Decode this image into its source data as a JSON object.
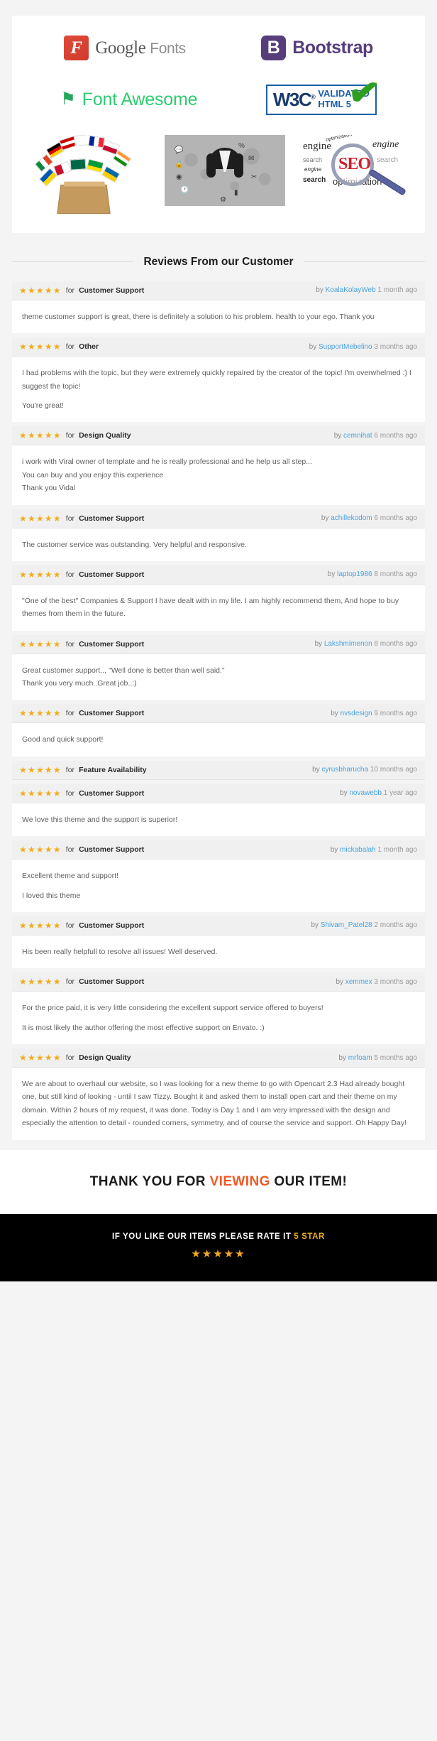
{
  "features": {
    "logos": [
      {
        "name": "google-fonts",
        "badge": "F",
        "text_strong": "Google",
        "text_light": "Fonts"
      },
      {
        "name": "bootstrap",
        "badge": "B",
        "text_strong": "Bootstrap",
        "text_light": ""
      },
      {
        "name": "font-awesome",
        "badge": "⚑",
        "text_strong": "Font Awesome",
        "text_light": ""
      },
      {
        "name": "w3c-validated-html5",
        "mark": "W3C",
        "sup": "®",
        "line1": "VALIDATED",
        "line2": "HTML 5",
        "check": "✔"
      }
    ],
    "illustrations": [
      {
        "name": "multi-language-flags"
      },
      {
        "name": "customer-support-agent"
      },
      {
        "name": "seo-optimization"
      }
    ],
    "seo_words": [
      "optimization",
      "engine",
      "search",
      "engine",
      "search",
      "engine",
      "search",
      "optimization",
      "SEO"
    ]
  },
  "reviews_section": {
    "title": "Reviews From our Customer",
    "star_glyph": "★",
    "for_label": "for",
    "by_label": "by",
    "items": [
      {
        "stars": 5,
        "category": "Customer Support",
        "user": "KoalaKolayWeb",
        "time": "1 month ago",
        "paragraphs": [
          "theme customer support is great, there is definitely a solution to his problem. health to your ego. Thank you"
        ]
      },
      {
        "stars": 5,
        "category": "Other",
        "user": "SupportMebelino",
        "time": "3 months ago",
        "paragraphs": [
          "I had problems with the topic, but they were extremely quickly repaired by the creator of the topic! I'm overwhelmed :) I suggest the topic!",
          "You're great!"
        ]
      },
      {
        "stars": 5,
        "category": "Design Quality",
        "user": "cemnihat",
        "time": "6 months ago",
        "paragraphs": [
          "i work with Viral owner of template and he is really professional and he help us all step...\nYou can buy and you enjoy this experience\nThank you Vidal"
        ]
      },
      {
        "stars": 5,
        "category": "Customer Support",
        "user": "achillekodom",
        "time": "6 months ago",
        "paragraphs": [
          "The customer service was outstanding. Very helpful and responsive."
        ]
      },
      {
        "stars": 5,
        "category": "Customer Support",
        "user": "laptop1986",
        "time": "8 months ago",
        "paragraphs": [
          "\"One of the best\" Companies & Support I have dealt with in my life. I am highly recommend them, And hope to buy themes from them in the future."
        ]
      },
      {
        "stars": 5,
        "category": "Customer Support",
        "user": "Lakshmimenon",
        "time": "8 months ago",
        "paragraphs": [
          "Great customer support.., \"Well done is better than well said.\"\nThank you very much..Great job..:)"
        ]
      },
      {
        "stars": 5,
        "category": "Customer Support",
        "user": "nvsdesign",
        "time": "9 months ago",
        "paragraphs": [
          "Good and quick support!"
        ]
      },
      {
        "stars": 5,
        "category": "Feature Availability",
        "user": "cyrusbharucha",
        "time": "10 months ago",
        "paragraphs": []
      },
      {
        "stars": 5,
        "category": "Customer Support",
        "user": "novawebb",
        "time": "1 year ago",
        "paragraphs": [
          "We love this theme and the support is superior!"
        ]
      },
      {
        "stars": 5,
        "category": "Customer Support",
        "user": "mickabalah",
        "time": "1 month ago",
        "paragraphs": [
          "Excellent theme and support!",
          "I loved this theme"
        ]
      },
      {
        "stars": 5,
        "category": "Customer Support",
        "user": "Shivam_Patel28",
        "time": "2 months ago",
        "paragraphs": [
          "His been really helpfull to resolve all issues! Well deserved."
        ]
      },
      {
        "stars": 5,
        "category": "Customer Support",
        "user": "xemmex",
        "time": "3 months ago",
        "paragraphs": [
          "For the price paid, it is very little considering the excellent support service offered to buyers!",
          "It is most likely the author offering the most effective support on Envato. :)"
        ]
      },
      {
        "stars": 5,
        "category": "Design Quality",
        "user": "mrfoam",
        "time": "5 months ago",
        "paragraphs": [
          "We are about to overhaul our website, so I was looking for a new theme to go with Opencart 2.3 Had already bought one, but still kind of looking - until I saw Tizzy. Bought it and asked them to install open cart and their theme on my domain. Within 2 hours of my request, it was done. Today is Day 1 and I am very impressed with the design and especially the attention to detail - rounded corners, symmetry, and of course the service and support. Oh Happy Day!"
        ]
      }
    ]
  },
  "thank_you": {
    "before": "THANK YOU FOR ",
    "highlight": "VIEWING",
    "after": " OUR ITEM!"
  },
  "footer": {
    "before": "IF YOU LIKE OUR ITEMS PLEASE RATE IT ",
    "highlight": "5 STAR",
    "stars": "★★★★★"
  },
  "colors": {
    "accent_orange": "#ef5924",
    "star_gold": "#f0ad1e",
    "link_blue": "#4aa3df",
    "bootstrap_purple": "#563d7c",
    "font_awesome_green": "#2ecc71",
    "google_red": "#d93b2b"
  }
}
